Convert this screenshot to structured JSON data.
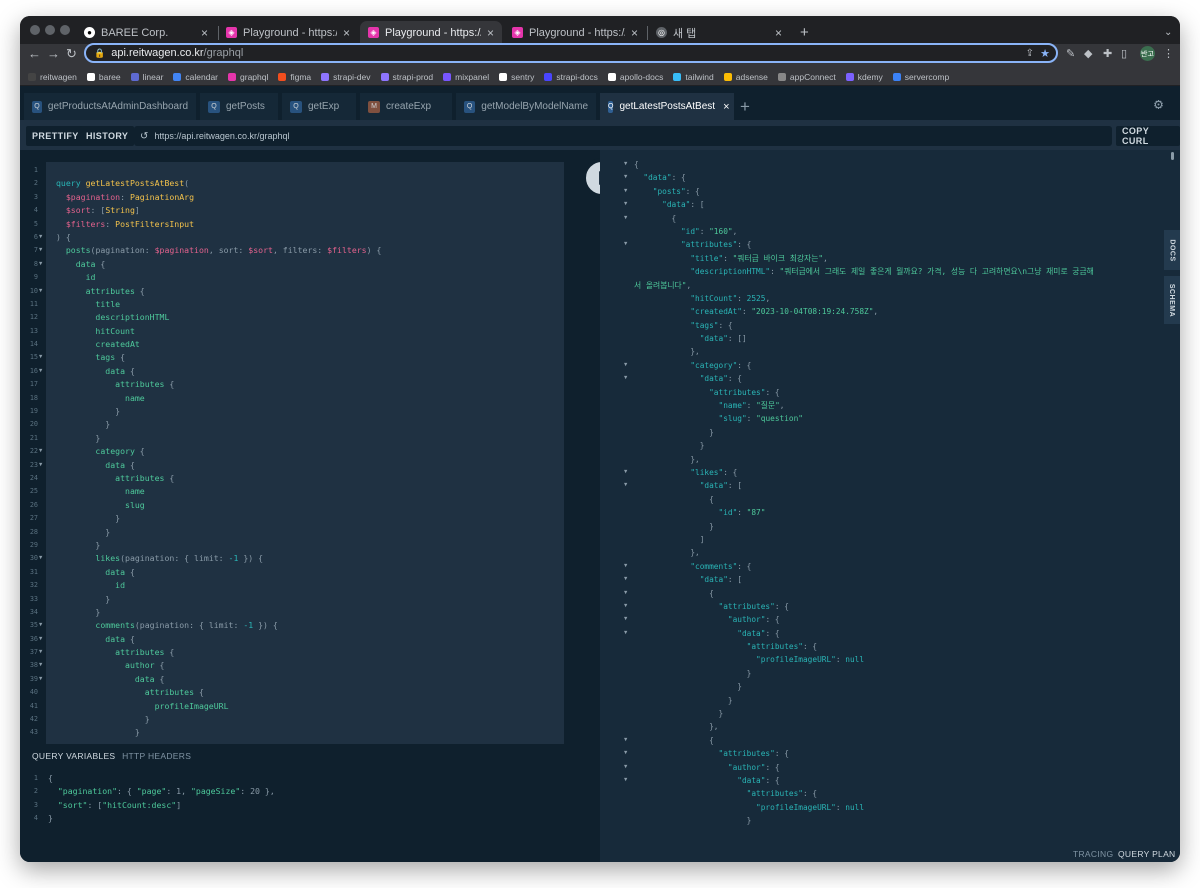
{
  "browser": {
    "tabs": [
      {
        "label": "BAREE Corp.",
        "icon": "github-icon"
      },
      {
        "label": "Playground - https://api.dev.re",
        "icon": "graphql-icon"
      },
      {
        "label": "Playground - https://api.reitwa",
        "icon": "graphql-icon"
      },
      {
        "label": "Playground - https://api.reitwa",
        "icon": "graphql-icon"
      },
      {
        "label": "새 탭",
        "icon": "chrome-icon"
      }
    ],
    "url_host": "api.reitwagen.co.kr",
    "url_path": "/graphql",
    "avatar": "반고",
    "bookmarks": [
      {
        "label": "reitwagen",
        "color": "#444444"
      },
      {
        "label": "baree",
        "color": "#ffffff"
      },
      {
        "label": "linear",
        "color": "#5e6ad2"
      },
      {
        "label": "calendar",
        "color": "#4285f4"
      },
      {
        "label": "graphql",
        "color": "#e535ab"
      },
      {
        "label": "figma",
        "color": "#f24e1e"
      },
      {
        "label": "strapi-dev",
        "color": "#8e75ff"
      },
      {
        "label": "strapi-prod",
        "color": "#8e75ff"
      },
      {
        "label": "mixpanel",
        "color": "#7856ff"
      },
      {
        "label": "sentry",
        "color": "#ffffff"
      },
      {
        "label": "strapi-docs",
        "color": "#4945ff"
      },
      {
        "label": "apollo-docs",
        "color": "#ffffff"
      },
      {
        "label": "tailwind",
        "color": "#38bdf8"
      },
      {
        "label": "adsense",
        "color": "#fbbc04"
      },
      {
        "label": "appConnect",
        "color": "#888888"
      },
      {
        "label": "kdemy",
        "color": "#7b61ff"
      },
      {
        "label": "servercomp",
        "color": "#3b82f6"
      }
    ]
  },
  "playground": {
    "query_tabs": [
      {
        "label": "getProductsAtAdminDashboard",
        "badge": "Q"
      },
      {
        "label": "getPosts",
        "badge": "Q"
      },
      {
        "label": "getExp",
        "badge": "Q"
      },
      {
        "label": "createExp",
        "badge": "M"
      },
      {
        "label": "getModelByModelName",
        "badge": "Q"
      },
      {
        "label": "getLatestPostsAtBest",
        "badge": "Q"
      }
    ],
    "prettify": "PRETTIFY",
    "history": "HISTORY",
    "endpoint": "https://api.reitwagen.co.kr/graphql",
    "copy_curl": "COPY CURL",
    "docs": "DOCS",
    "schema": "SCHEMA",
    "query_variables_tab": "QUERY VARIABLES",
    "http_headers_tab": "HTTP HEADERS",
    "tracing": "TRACING",
    "query_plan": "QUERY PLAN"
  },
  "query_lines": [
    [],
    [
      [
        "kw",
        "query "
      ],
      [
        "fn",
        "getLatestPostsAtBest"
      ],
      [
        "pu",
        "("
      ]
    ],
    [
      [
        "vr",
        "  $pagination"
      ],
      [
        "pu",
        ": "
      ],
      [
        "ty",
        "PaginationArg"
      ]
    ],
    [
      [
        "vr",
        "  $sort"
      ],
      [
        "pu",
        ": ["
      ],
      [
        "ty",
        "String"
      ],
      [
        "pu",
        "]"
      ]
    ],
    [
      [
        "vr",
        "  $filters"
      ],
      [
        "pu",
        ": "
      ],
      [
        "ty",
        "PostFiltersInput"
      ]
    ],
    [
      [
        "pu",
        ") {"
      ]
    ],
    [
      [
        "fd",
        "  posts"
      ],
      [
        "pu",
        "(pagination: "
      ],
      [
        "vr",
        "$pagination"
      ],
      [
        "pu",
        ", sort: "
      ],
      [
        "vr",
        "$sort"
      ],
      [
        "pu",
        ", filters: "
      ],
      [
        "vr",
        "$filters"
      ],
      [
        "pu",
        ") {"
      ]
    ],
    [
      [
        "fd",
        "    data"
      ],
      [
        "pu",
        " {"
      ]
    ],
    [
      [
        "fd",
        "      id"
      ]
    ],
    [
      [
        "fd",
        "      attributes"
      ],
      [
        "pu",
        " {"
      ]
    ],
    [
      [
        "fd",
        "        title"
      ]
    ],
    [
      [
        "fd",
        "        descriptionHTML"
      ]
    ],
    [
      [
        "fd",
        "        hitCount"
      ]
    ],
    [
      [
        "fd",
        "        createdAt"
      ]
    ],
    [
      [
        "fd",
        "        tags"
      ],
      [
        "pu",
        " {"
      ]
    ],
    [
      [
        "fd",
        "          data"
      ],
      [
        "pu",
        " {"
      ]
    ],
    [
      [
        "fd",
        "            attributes"
      ],
      [
        "pu",
        " {"
      ]
    ],
    [
      [
        "fd",
        "              name"
      ]
    ],
    [
      [
        "pu",
        "            }"
      ]
    ],
    [
      [
        "pu",
        "          }"
      ]
    ],
    [
      [
        "pu",
        "        }"
      ]
    ],
    [
      [
        "fd",
        "        category"
      ],
      [
        "pu",
        " {"
      ]
    ],
    [
      [
        "fd",
        "          data"
      ],
      [
        "pu",
        " {"
      ]
    ],
    [
      [
        "fd",
        "            attributes"
      ],
      [
        "pu",
        " {"
      ]
    ],
    [
      [
        "fd",
        "              name"
      ]
    ],
    [
      [
        "fd",
        "              slug"
      ]
    ],
    [
      [
        "pu",
        "            }"
      ]
    ],
    [
      [
        "pu",
        "          }"
      ]
    ],
    [
      [
        "pu",
        "        }"
      ]
    ],
    [
      [
        "fd",
        "        likes"
      ],
      [
        "pu",
        "(pagination: { limit: "
      ],
      [
        "nu",
        "-1"
      ],
      [
        "pu",
        " }) {"
      ]
    ],
    [
      [
        "fd",
        "          data"
      ],
      [
        "pu",
        " {"
      ]
    ],
    [
      [
        "fd",
        "            id"
      ]
    ],
    [
      [
        "pu",
        "          }"
      ]
    ],
    [
      [
        "pu",
        "        }"
      ]
    ],
    [
      [
        "fd",
        "        comments"
      ],
      [
        "pu",
        "(pagination: { limit: "
      ],
      [
        "nu",
        "-1"
      ],
      [
        "pu",
        " }) {"
      ]
    ],
    [
      [
        "fd",
        "          data"
      ],
      [
        "pu",
        " {"
      ]
    ],
    [
      [
        "fd",
        "            attributes"
      ],
      [
        "pu",
        " {"
      ]
    ],
    [
      [
        "fd",
        "              author"
      ],
      [
        "pu",
        " {"
      ]
    ],
    [
      [
        "fd",
        "                data"
      ],
      [
        "pu",
        " {"
      ]
    ],
    [
      [
        "fd",
        "                  attributes"
      ],
      [
        "pu",
        " {"
      ]
    ],
    [
      [
        "fd",
        "                    profileImageURL"
      ]
    ],
    [
      [
        "pu",
        "                  }"
      ]
    ],
    [
      [
        "pu",
        "                }"
      ]
    ]
  ],
  "query_folds": [
    6,
    7,
    8,
    10,
    15,
    16,
    22,
    23,
    30,
    35,
    36,
    37,
    38,
    39
  ],
  "variables_lines": [
    [
      [
        "vp",
        "{"
      ]
    ],
    [
      [
        "vs",
        "  \"pagination\""
      ],
      [
        "vp",
        ": { "
      ],
      [
        "vs",
        "\"page\""
      ],
      [
        "vp",
        ": 1, "
      ],
      [
        "vs",
        "\"pageSize\""
      ],
      [
        "vp",
        ": 20 },"
      ]
    ],
    [
      [
        "vs",
        "  \"sort\""
      ],
      [
        "vp",
        ": ["
      ],
      [
        "vs",
        "\"hitCount:desc\""
      ],
      [
        "vp",
        "]"
      ]
    ],
    [
      [
        "vp",
        "}"
      ]
    ]
  ],
  "result_lines": [
    {
      "f": 1,
      "t": [
        [
          "rp",
          "{"
        ]
      ]
    },
    {
      "f": 1,
      "t": [
        [
          "rk",
          "  \"data\""
        ],
        [
          "rp",
          ": {"
        ]
      ]
    },
    {
      "f": 1,
      "t": [
        [
          "rk",
          "    \"posts\""
        ],
        [
          "rp",
          ": {"
        ]
      ]
    },
    {
      "f": 1,
      "t": [
        [
          "rk",
          "      \"data\""
        ],
        [
          "rp",
          ": ["
        ]
      ]
    },
    {
      "f": 1,
      "t": [
        [
          "rp",
          "        {"
        ]
      ]
    },
    {
      "f": 0,
      "t": [
        [
          "rk",
          "          \"id\""
        ],
        [
          "rp",
          ": "
        ],
        [
          "rs",
          "\"160\""
        ],
        [
          "rp",
          ","
        ]
      ]
    },
    {
      "f": 1,
      "t": [
        [
          "rk",
          "          \"attributes\""
        ],
        [
          "rp",
          ": {"
        ]
      ]
    },
    {
      "f": 0,
      "t": [
        [
          "rk",
          "            \"title\""
        ],
        [
          "rp",
          ": "
        ],
        [
          "rs",
          "\"쿼터급 바이크 최강자는\""
        ],
        [
          "rp",
          ","
        ]
      ]
    },
    {
      "f": 0,
      "t": [
        [
          "rk",
          "            \"descriptionHTML\""
        ],
        [
          "rp",
          ": "
        ],
        [
          "rs",
          "\"쿼터급에서 그래도 제일 좋은게 뭘까요? 가격, 성능 다 고려하면요\\n그냥 재미로 궁금해"
        ]
      ]
    },
    {
      "f": 0,
      "t": [
        [
          "rs",
          "서 올려봅니다\""
        ],
        [
          "rp",
          ","
        ]
      ]
    },
    {
      "f": 0,
      "t": [
        [
          "rk",
          "            \"hitCount\""
        ],
        [
          "rp",
          ": "
        ],
        [
          "rn",
          "2525"
        ],
        [
          "rp",
          ","
        ]
      ]
    },
    {
      "f": 0,
      "t": [
        [
          "rk",
          "            \"createdAt\""
        ],
        [
          "rp",
          ": "
        ],
        [
          "rs",
          "\"2023-10-04T08:19:24.758Z\""
        ],
        [
          "rp",
          ","
        ]
      ]
    },
    {
      "f": 0,
      "t": [
        [
          "rk",
          "            \"tags\""
        ],
        [
          "rp",
          ": {"
        ]
      ]
    },
    {
      "f": 0,
      "t": [
        [
          "rk",
          "              \"data\""
        ],
        [
          "rp",
          ": []"
        ]
      ]
    },
    {
      "f": 0,
      "t": [
        [
          "rp",
          "            },"
        ]
      ]
    },
    {
      "f": 1,
      "t": [
        [
          "rk",
          "            \"category\""
        ],
        [
          "rp",
          ": {"
        ]
      ]
    },
    {
      "f": 1,
      "t": [
        [
          "rk",
          "              \"data\""
        ],
        [
          "rp",
          ": {"
        ]
      ]
    },
    {
      "f": 0,
      "t": [
        [
          "rk",
          "                \"attributes\""
        ],
        [
          "rp",
          ": {"
        ]
      ]
    },
    {
      "f": 0,
      "t": [
        [
          "rk",
          "                  \"name\""
        ],
        [
          "rp",
          ": "
        ],
        [
          "rs",
          "\"질문\""
        ],
        [
          "rp",
          ","
        ]
      ]
    },
    {
      "f": 0,
      "t": [
        [
          "rk",
          "                  \"slug\""
        ],
        [
          "rp",
          ": "
        ],
        [
          "rs",
          "\"question\""
        ]
      ]
    },
    {
      "f": 0,
      "t": [
        [
          "rp",
          "                }"
        ]
      ]
    },
    {
      "f": 0,
      "t": [
        [
          "rp",
          "              }"
        ]
      ]
    },
    {
      "f": 0,
      "t": [
        [
          "rp",
          "            },"
        ]
      ]
    },
    {
      "f": 1,
      "t": [
        [
          "rk",
          "            \"likes\""
        ],
        [
          "rp",
          ": {"
        ]
      ]
    },
    {
      "f": 1,
      "t": [
        [
          "rk",
          "              \"data\""
        ],
        [
          "rp",
          ": ["
        ]
      ]
    },
    {
      "f": 0,
      "t": [
        [
          "rp",
          "                {"
        ]
      ]
    },
    {
      "f": 0,
      "t": [
        [
          "rk",
          "                  \"id\""
        ],
        [
          "rp",
          ": "
        ],
        [
          "rs",
          "\"87\""
        ]
      ]
    },
    {
      "f": 0,
      "t": [
        [
          "rp",
          "                }"
        ]
      ]
    },
    {
      "f": 0,
      "t": [
        [
          "rp",
          "              ]"
        ]
      ]
    },
    {
      "f": 0,
      "t": [
        [
          "rp",
          "            },"
        ]
      ]
    },
    {
      "f": 1,
      "t": [
        [
          "rk",
          "            \"comments\""
        ],
        [
          "rp",
          ": {"
        ]
      ]
    },
    {
      "f": 1,
      "t": [
        [
          "rk",
          "              \"data\""
        ],
        [
          "rp",
          ": ["
        ]
      ]
    },
    {
      "f": 1,
      "t": [
        [
          "rp",
          "                {"
        ]
      ]
    },
    {
      "f": 1,
      "t": [
        [
          "rk",
          "                  \"attributes\""
        ],
        [
          "rp",
          ": {"
        ]
      ]
    },
    {
      "f": 1,
      "t": [
        [
          "rk",
          "                    \"author\""
        ],
        [
          "rp",
          ": {"
        ]
      ]
    },
    {
      "f": 1,
      "t": [
        [
          "rk",
          "                      \"data\""
        ],
        [
          "rp",
          ": {"
        ]
      ]
    },
    {
      "f": 0,
      "t": [
        [
          "rk",
          "                        \"attributes\""
        ],
        [
          "rp",
          ": {"
        ]
      ]
    },
    {
      "f": 0,
      "t": [
        [
          "rk",
          "                          \"profileImageURL\""
        ],
        [
          "rp",
          ": "
        ],
        [
          "rn",
          "null"
        ]
      ]
    },
    {
      "f": 0,
      "t": [
        [
          "rp",
          "                        }"
        ]
      ]
    },
    {
      "f": 0,
      "t": [
        [
          "rp",
          "                      }"
        ]
      ]
    },
    {
      "f": 0,
      "t": [
        [
          "rp",
          "                    }"
        ]
      ]
    },
    {
      "f": 0,
      "t": [
        [
          "rp",
          "                  }"
        ]
      ]
    },
    {
      "f": 0,
      "t": [
        [
          "rp",
          "                },"
        ]
      ]
    },
    {
      "f": 1,
      "t": [
        [
          "rp",
          "                {"
        ]
      ]
    },
    {
      "f": 1,
      "t": [
        [
          "rk",
          "                  \"attributes\""
        ],
        [
          "rp",
          ": {"
        ]
      ]
    },
    {
      "f": 1,
      "t": [
        [
          "rk",
          "                    \"author\""
        ],
        [
          "rp",
          ": {"
        ]
      ]
    },
    {
      "f": 1,
      "t": [
        [
          "rk",
          "                      \"data\""
        ],
        [
          "rp",
          ": {"
        ]
      ]
    },
    {
      "f": 0,
      "t": [
        [
          "rk",
          "                        \"attributes\""
        ],
        [
          "rp",
          ": {"
        ]
      ]
    },
    {
      "f": 0,
      "t": [
        [
          "rk",
          "                          \"profileImageURL\""
        ],
        [
          "rp",
          ": "
        ],
        [
          "rn",
          "null"
        ]
      ]
    },
    {
      "f": 0,
      "t": [
        [
          "rp",
          "                        }"
        ]
      ]
    }
  ]
}
